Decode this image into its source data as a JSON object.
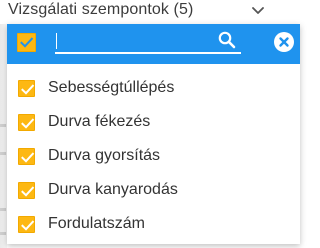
{
  "select": {
    "label": "Vizsgálati szempontok (5)",
    "chevron_icon": "chevron-down-icon"
  },
  "dropdown": {
    "header_color": "#1f93ee",
    "select_all_checked": true,
    "search": {
      "value": "",
      "placeholder": "",
      "icon": "search-icon"
    },
    "clear_icon": "close-icon",
    "checkbox_color": "#fdb813",
    "options": [
      {
        "label": "Sebességtúllépés",
        "checked": true
      },
      {
        "label": "Durva fékezés",
        "checked": true
      },
      {
        "label": "Durva gyorsítás",
        "checked": true
      },
      {
        "label": "Durva kanyarodás",
        "checked": true
      },
      {
        "label": "Fordulatszám",
        "checked": true
      }
    ]
  }
}
